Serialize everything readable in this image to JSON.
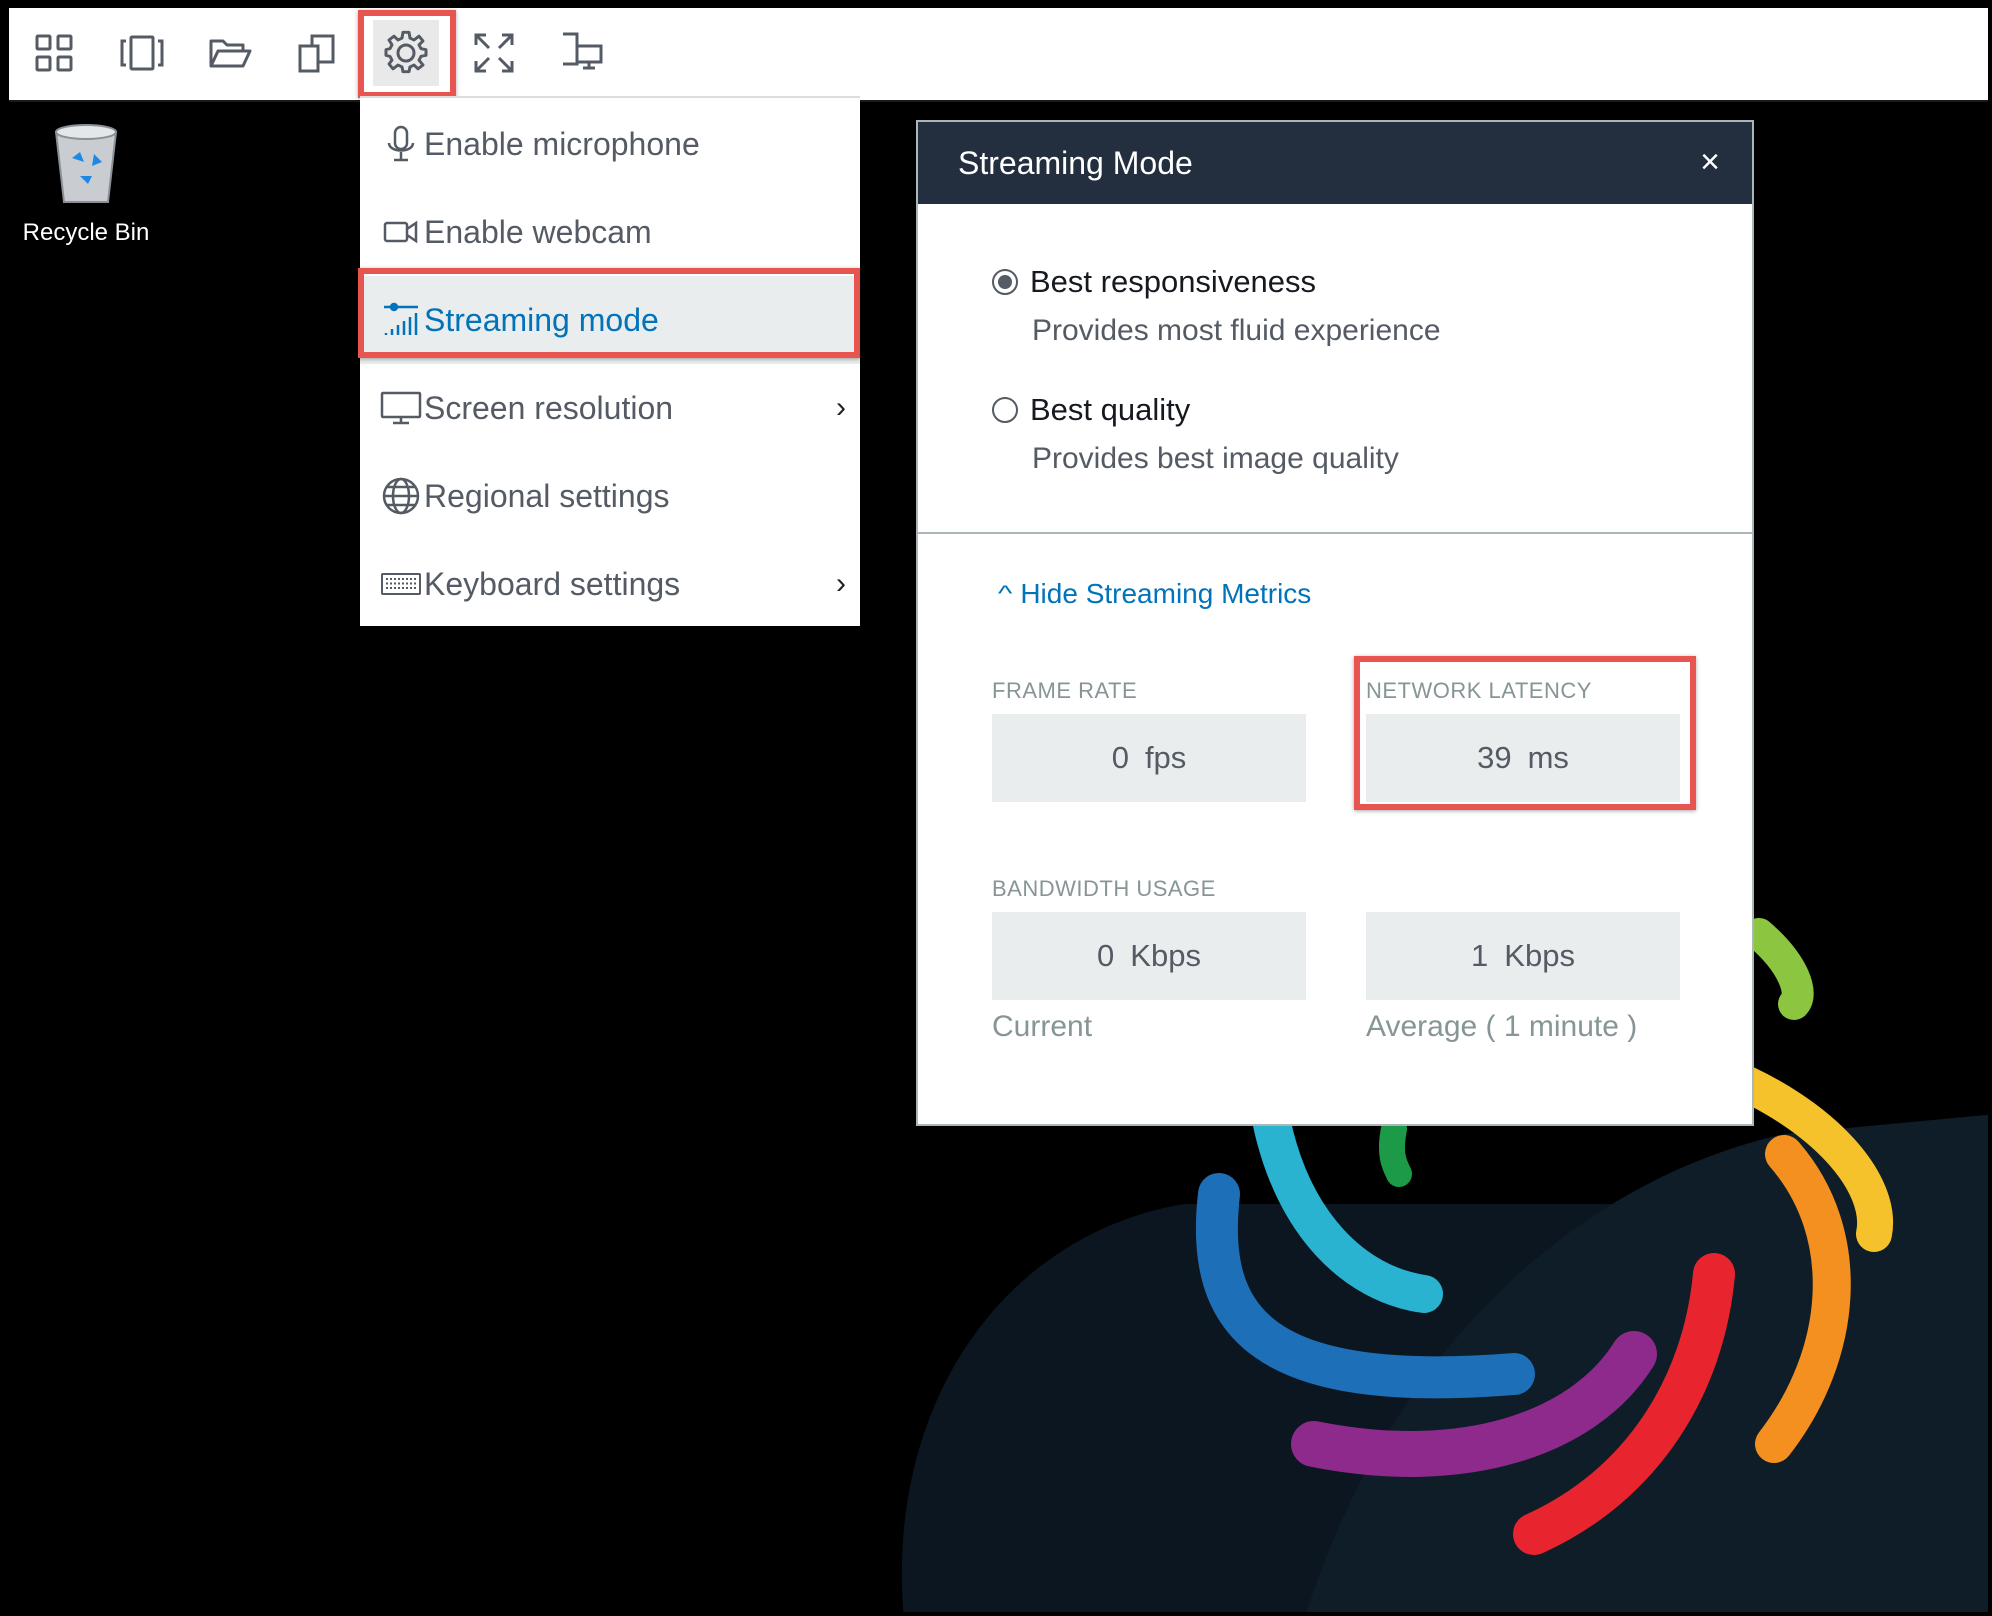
{
  "toolbar": {
    "buttons": [
      {
        "icon": "grid-icon"
      },
      {
        "icon": "windows-icon"
      },
      {
        "icon": "folder-icon"
      },
      {
        "icon": "clipboard-icon"
      },
      {
        "icon": "gear-icon",
        "active": true
      },
      {
        "icon": "fullscreen-icon"
      },
      {
        "icon": "dual-monitor-icon"
      }
    ]
  },
  "desktop": {
    "recycle_bin_label": "Recycle Bin"
  },
  "settings_menu": {
    "items": [
      {
        "label": "Enable microphone",
        "icon": "microphone-icon"
      },
      {
        "label": "Enable webcam",
        "icon": "webcam-icon"
      },
      {
        "label": "Streaming mode",
        "icon": "signal-icon",
        "selected": true
      },
      {
        "label": "Screen resolution",
        "icon": "monitor-icon",
        "chevron": "›"
      },
      {
        "label": "Regional settings",
        "icon": "globe-icon"
      },
      {
        "label": "Keyboard settings",
        "icon": "keyboard-icon",
        "chevron": "›"
      }
    ]
  },
  "dialog": {
    "title": "Streaming Mode",
    "close_glyph": "×",
    "options": [
      {
        "label": "Best responsiveness",
        "description": "Provides most fluid experience",
        "selected": true
      },
      {
        "label": "Best quality",
        "description": "Provides best image quality",
        "selected": false
      }
    ],
    "metrics_toggle": {
      "caret": "^",
      "label": "Hide Streaming Metrics"
    },
    "metrics": {
      "frame_rate": {
        "heading": "FRAME RATE",
        "value": "0",
        "unit": "fps"
      },
      "network_latency": {
        "heading": "NETWORK LATENCY",
        "value": "39",
        "unit": "ms"
      },
      "bandwidth": {
        "heading": "BANDWIDTH USAGE",
        "current": {
          "value": "0",
          "unit": "Kbps",
          "caption": "Current"
        },
        "average": {
          "value": "1",
          "unit": "Kbps",
          "caption": "Average ( 1 minute )"
        }
      }
    }
  },
  "colors": {
    "highlight": "#e8544f",
    "header_bg": "#232f3e",
    "link_blue": "#0073bb",
    "metric_bg": "#eaeded"
  }
}
